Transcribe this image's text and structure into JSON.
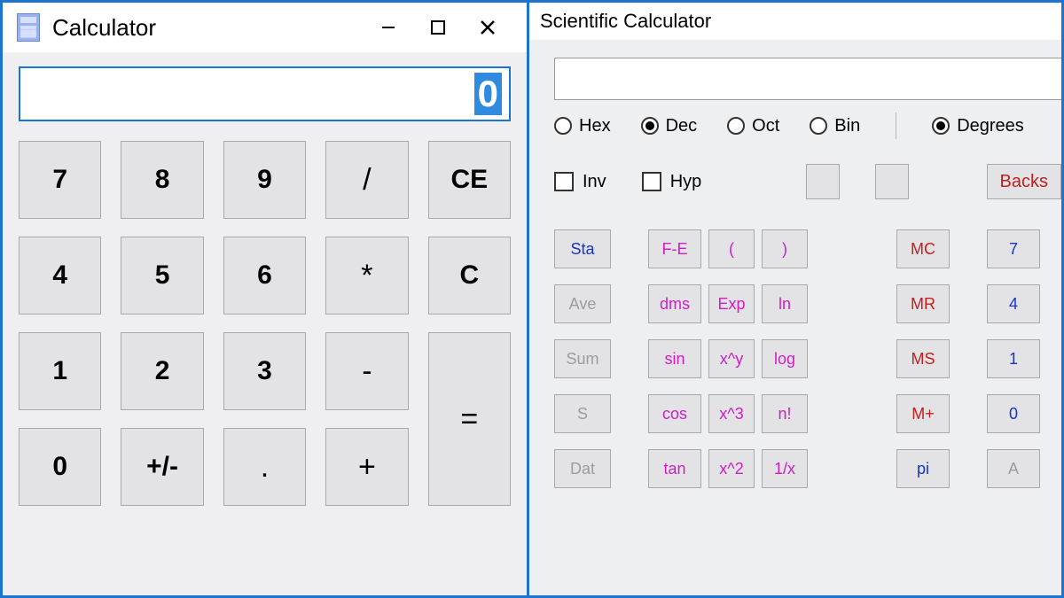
{
  "basic": {
    "title": "Calculator",
    "display_value": "0",
    "keys": {
      "k7": "7",
      "k8": "8",
      "k9": "9",
      "div": "/",
      "ce": "CE",
      "k4": "4",
      "k5": "5",
      "k6": "6",
      "mul": "*",
      "c": "C",
      "k1": "1",
      "k2": "2",
      "k3": "3",
      "sub": "-",
      "eq": "=",
      "k0": "0",
      "sign": "+/-",
      "dot": ".",
      "add": "+"
    }
  },
  "sci": {
    "title": "Scientific Calculator",
    "display_value": "",
    "number_modes": [
      "Hex",
      "Dec",
      "Oct",
      "Bin"
    ],
    "number_mode_selected": "Dec",
    "angle_modes": [
      "Degrees"
    ],
    "angle_mode_selected": "Degrees",
    "checkboxes": {
      "inv_label": "Inv",
      "hyp_label": "Hyp"
    },
    "backspace_label": "Backs",
    "keys": {
      "sta": "Sta",
      "fe": "F-E",
      "lparen": "(",
      "rparen": ")",
      "mc": "MC",
      "d7": "7",
      "ave": "Ave",
      "dms": "dms",
      "exp": "Exp",
      "ln": "ln",
      "mr": "MR",
      "d4": "4",
      "sum": "Sum",
      "sin": "sin",
      "xy": "x^y",
      "log": "log",
      "ms": "MS",
      "d1": "1",
      "s": "S",
      "cos": "cos",
      "x3": "x^3",
      "nfact": "n!",
      "mplus": "M+",
      "d0": "0",
      "dat": "Dat",
      "tan": "tan",
      "x2": "x^2",
      "recip": "1/x",
      "pi": "pi",
      "a": "A"
    }
  }
}
